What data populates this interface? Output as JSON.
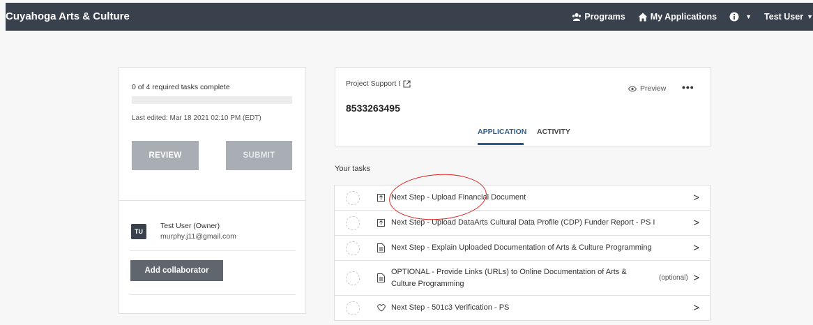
{
  "navbar": {
    "brand": "Cuyahoga Arts & Culture",
    "programs_label": "Programs",
    "applications_label": "My Applications",
    "user_label": "Test User",
    "icons": {
      "programs": "people-icon",
      "applications": "home-icon",
      "info": "info-icon",
      "caret": "caret-down-icon"
    }
  },
  "status": {
    "task_count": "0 of 4 required tasks complete",
    "progress": 0,
    "last_edited": "Last edited: Mar 18 2021 02:10 PM (EDT)",
    "review_label": "REVIEW",
    "submit_label": "SUBMIT"
  },
  "collaborators": {
    "owner_initials": "TU",
    "owner_name": "Test User (Owner)",
    "owner_email": "murphy.j11@gmail.com",
    "add_label": "Add collaborator"
  },
  "project": {
    "label": "Project Support I",
    "id": "8533263495",
    "preview_label": "Preview",
    "more_label": "•••",
    "tabs": [
      {
        "label": "APPLICATION",
        "active": true
      },
      {
        "label": "ACTIVITY",
        "active": false
      }
    ]
  },
  "tasks": {
    "title": "Your tasks",
    "items": [
      {
        "icon": "upload-icon",
        "text": "Next Step - Upload Financial Document",
        "optional": ""
      },
      {
        "icon": "upload-icon",
        "text": "Next Step - Upload DataArts Cultural Data Profile (CDP) Funder Report - PS I",
        "optional": ""
      },
      {
        "icon": "document-icon",
        "text": "Next Step - Explain Uploaded Documentation of Arts & Culture Programming",
        "optional": ""
      },
      {
        "icon": "document-icon",
        "text": "OPTIONAL - Provide Links (URLs) to Online Documentation of Arts & Culture Programming",
        "optional": "(optional)"
      },
      {
        "icon": "heart-icon",
        "text": "Next Step - 501c3 Verification - PS",
        "optional": ""
      }
    ]
  },
  "colors": {
    "navbar": "#39414c",
    "accent": "#2e5c8a",
    "annotation": "#e02020"
  }
}
